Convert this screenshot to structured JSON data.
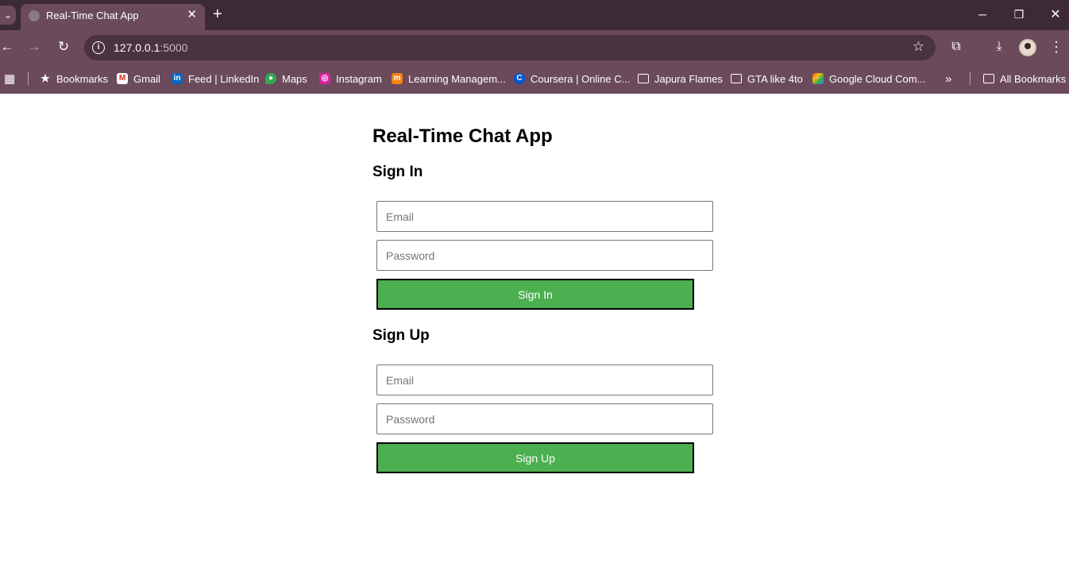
{
  "browser": {
    "tab_title": "Real-Time Chat App",
    "url_host": "127.0.0.1",
    "url_port": ":5000",
    "bookmarks": [
      {
        "label": "Bookmarks",
        "icon": "star-icon"
      },
      {
        "label": "Gmail",
        "icon": "gmail-icon"
      },
      {
        "label": "Feed | LinkedIn",
        "icon": "linkedin-icon"
      },
      {
        "label": "Maps",
        "icon": "maps-icon"
      },
      {
        "label": "Instagram",
        "icon": "instagram-icon"
      },
      {
        "label": "Learning Managem...",
        "icon": "moodle-icon"
      },
      {
        "label": "Coursera | Online C...",
        "icon": "coursera-icon"
      },
      {
        "label": "Japura Flames",
        "icon": "folder-icon"
      },
      {
        "label": "GTA like 4to",
        "icon": "folder-icon"
      },
      {
        "label": "Google Cloud Com...",
        "icon": "google-cloud-icon"
      }
    ],
    "all_bookmarks": "All Bookmarks"
  },
  "app": {
    "title": "Real-Time Chat App",
    "signin": {
      "heading": "Sign In",
      "email_placeholder": "Email",
      "password_placeholder": "Password",
      "button_label": "Sign In"
    },
    "signup": {
      "heading": "Sign Up",
      "email_placeholder": "Email",
      "password_placeholder": "Password",
      "button_label": "Sign Up"
    }
  },
  "colors": {
    "chrome_dark": "#3c2b35",
    "chrome_mid": "#6b4a5c",
    "button_green": "#4caf50"
  }
}
